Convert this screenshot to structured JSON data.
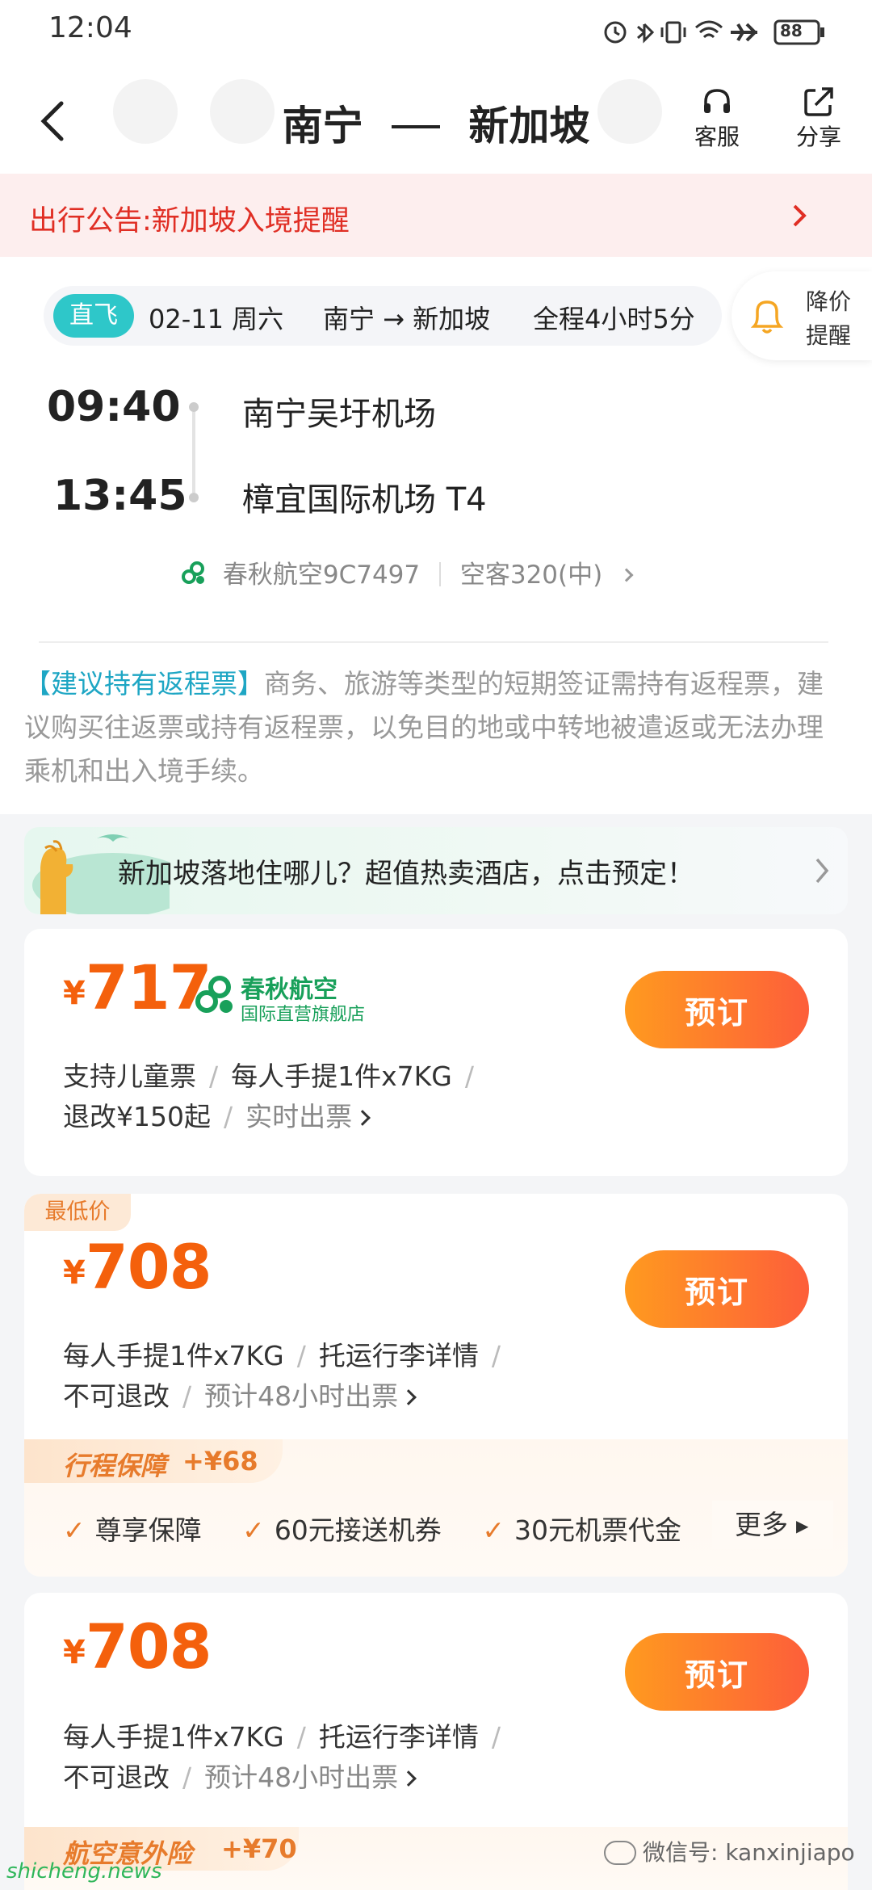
{
  "status_bar": {
    "time": "12:04",
    "battery": "88"
  },
  "nav": {
    "title_from": "南宁",
    "title_to": "新加坡",
    "service_label": "客服",
    "share_label": "分享"
  },
  "notice": {
    "text": "出行公告:新加坡入境提醒"
  },
  "flight": {
    "tag": "直飞",
    "date": "02-11 周六",
    "route": "南宁 → 新加坡",
    "duration": "全程4小时5分",
    "alert_label_1": "降价",
    "alert_label_2": "提醒",
    "depart_time": "09:40",
    "depart_airport": "南宁吴圩机场",
    "arrive_time": "13:45",
    "arrive_airport": "樟宜国际机场 T4",
    "airline": "春秋航空9C7497",
    "aircraft": "空客320(中)"
  },
  "advice": {
    "highlight": "【建议持有返程票】",
    "text": "商务、旅游等类型的短期签证需持有返程票，建议购买往返票或持有返程票，以免目的地或中转地被遣返或无法办理乘机和出入境手续。"
  },
  "hotel_banner": {
    "text": "新加坡落地住哪儿？超值热卖酒店，点击预定！"
  },
  "offers": [
    {
      "price": "717",
      "airline_name": "春秋航空",
      "airline_sub": "国际直营旗舰店",
      "book_label": "预订",
      "features_line1": [
        "支持儿童票",
        "每人手提1件x7KG"
      ],
      "features_line2": [
        "退改¥150起"
      ],
      "issue_text": "实时出票"
    },
    {
      "badge": "最低价",
      "price": "708",
      "book_label": "预订",
      "features_line1": [
        "每人手提1件x7KG",
        "托运行李详情"
      ],
      "features_line2": [
        "不可退改"
      ],
      "issue_text": "预计48小时出票",
      "protection_title": "行程保障",
      "protection_price": "+¥68",
      "protection_items": [
        "尊享保障",
        "60元接送机券",
        "30元机票代金"
      ],
      "protection_more": "更多"
    },
    {
      "price": "708",
      "book_label": "预订",
      "features_line1": [
        "每人手提1件x7KG",
        "托运行李详情"
      ],
      "features_line2": [
        "不可退改"
      ],
      "issue_text": "预计48小时出票",
      "insurance_title": "航空意外险",
      "insurance_price": "+¥70"
    }
  ],
  "watermarks": {
    "wechat": "微信号: kanxinjiapo",
    "site": "shicheng.news"
  },
  "colors": {
    "accent": "#f4600c",
    "brand_green": "#18a05a",
    "teal": "#2ec7c9",
    "notice_red": "#e02e24"
  }
}
